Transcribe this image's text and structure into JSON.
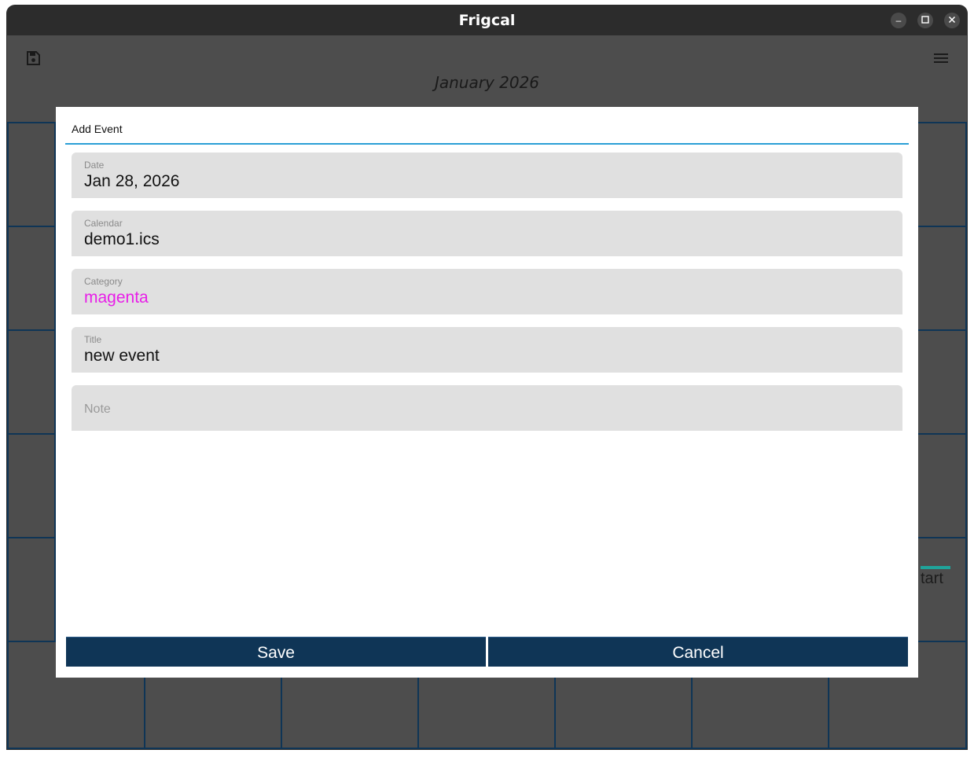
{
  "window": {
    "title": "Frigcal"
  },
  "window_controls": {
    "minimize": "–",
    "maximize": "☐",
    "close": "✕"
  },
  "appbar": {
    "month_title": "January 2026",
    "save_icon": "save-disk-icon",
    "menu_icon": "hamburger-menu-icon"
  },
  "background_peek_text": "tart",
  "dialog": {
    "title": "Add Event",
    "fields": {
      "date": {
        "label": "Date",
        "value": "Jan 28, 2026"
      },
      "calendar": {
        "label": "Calendar",
        "value": "demo1.ics"
      },
      "category": {
        "label": "Category",
        "value": "magenta",
        "color": "#e81ee8"
      },
      "title": {
        "label": "Title",
        "value": "new event"
      },
      "note": {
        "placeholder": "Note",
        "value": ""
      }
    },
    "buttons": {
      "save": "Save",
      "cancel": "Cancel"
    }
  },
  "colors": {
    "accent": "#2a9fd6",
    "button_bg": "#0f3556",
    "grid_line": "#0f3556",
    "app_bg": "#4d4d4d"
  }
}
